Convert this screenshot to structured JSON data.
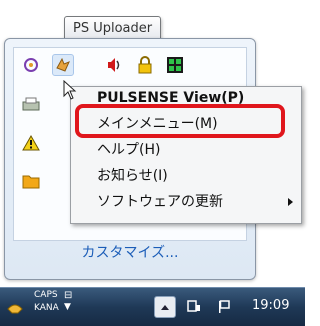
{
  "tooltip": {
    "text": "PS Uploader"
  },
  "flyout": {
    "customize_label": "カスタマイズ...",
    "icons": [
      "app-spiral-icon",
      "uploader-icon",
      "speaker-icon",
      "lock-icon",
      "grid-app-icon",
      "printer-icon",
      "warning-icon",
      "folder-icon"
    ]
  },
  "context_menu": {
    "items": [
      {
        "label": "PULSENSE View(P)",
        "bold": true
      },
      {
        "label": "メインメニュー(M)",
        "highlighted": true
      },
      {
        "label": "ヘルプ(H)"
      },
      {
        "label": "お知らせ(I)"
      },
      {
        "label": "ソフトウェアの更新",
        "has_submenu": true
      }
    ]
  },
  "taskbar": {
    "ime_top": "CAPS",
    "ime_bottom": "KANA",
    "clock": "19:09"
  },
  "colors": {
    "highlight_border": "#e0161c",
    "link": "#1b5db8"
  }
}
